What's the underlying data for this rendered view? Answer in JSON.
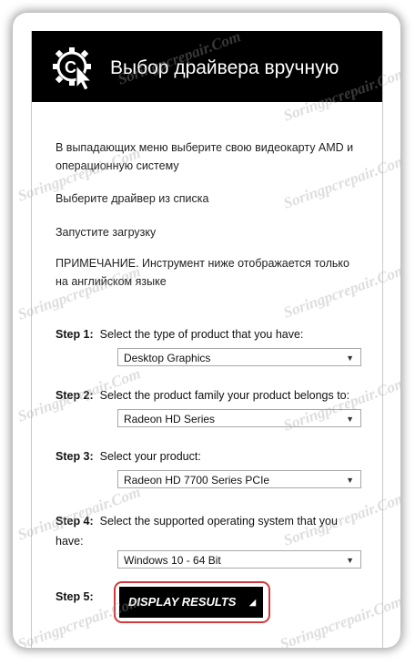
{
  "header": {
    "title": "Выбор драйвера вручную",
    "logo_icon": "gear-cursor-icon"
  },
  "intro": {
    "line1": "В выпадающих меню выберите свою видеокарту AMD и",
    "line1b": "операционную систему",
    "line2": "Выберите драйвер из списка",
    "line3": "Запустите загрузку",
    "line4": "ПРИМЕЧАНИЕ. Инструмент ниже отображается только",
    "line4b": "на английском языке"
  },
  "steps": [
    {
      "label": "Step 1:",
      "text": "Select the type of product that you have:",
      "value": "Desktop Graphics"
    },
    {
      "label": "Step 2:",
      "text": "Select the product family your product belongs to:",
      "value": "Radeon HD Series"
    },
    {
      "label": "Step 3:",
      "text": "Select your product:",
      "value": "Radeon HD 7700 Series PCIe"
    },
    {
      "label": "Step 4:",
      "text": "Select the supported operating system that you",
      "text2": "have:",
      "value": "Windows 10 - 64 Bit"
    },
    {
      "label": "Step 5:"
    }
  ],
  "button": {
    "label": "DISPLAY RESULTS"
  },
  "watermark": "Soringpcrepair.Com",
  "colors": {
    "header_bg": "#000000",
    "highlight": "#d13a3a"
  }
}
